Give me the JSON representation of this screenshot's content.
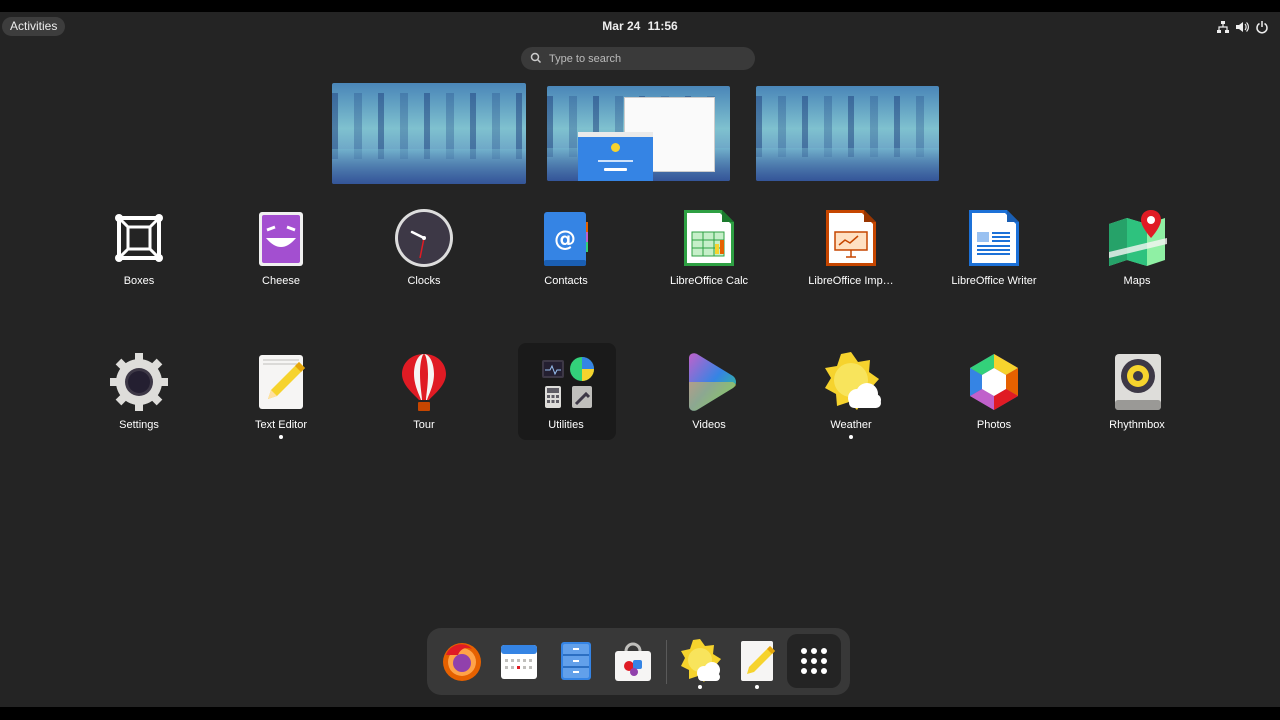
{
  "topbar": {
    "activities": "Activities",
    "date": "Mar 24",
    "time": "11:56",
    "tray_icons": [
      "network-icon",
      "volume-icon",
      "power-icon"
    ]
  },
  "search": {
    "placeholder": "Type to search"
  },
  "workspaces": [
    {
      "name": "workspace-1",
      "windows": []
    },
    {
      "name": "workspace-2",
      "windows": [
        "Welcome to Weather window",
        "blank white window"
      ]
    },
    {
      "name": "workspace-3",
      "windows": []
    }
  ],
  "apps": {
    "row1": [
      {
        "label": "Boxes",
        "icon": "boxes-icon"
      },
      {
        "label": "Cheese",
        "icon": "cheese-icon"
      },
      {
        "label": "Clocks",
        "icon": "clocks-icon"
      },
      {
        "label": "Contacts",
        "icon": "contacts-icon"
      },
      {
        "label": "LibreOffice Calc",
        "icon": "libreoffice-calc-icon"
      },
      {
        "label": "LibreOffice Imp…",
        "icon": "libreoffice-impress-icon"
      },
      {
        "label": "LibreOffice Writer",
        "icon": "libreoffice-writer-icon"
      },
      {
        "label": "Maps",
        "icon": "maps-icon"
      }
    ],
    "row2": [
      {
        "label": "Settings",
        "icon": "settings-icon"
      },
      {
        "label": "Text Editor",
        "icon": "text-editor-icon",
        "running": true
      },
      {
        "label": "Tour",
        "icon": "tour-icon"
      },
      {
        "label": "Utilities",
        "icon": "utilities-folder-icon"
      },
      {
        "label": "Videos",
        "icon": "videos-icon"
      },
      {
        "label": "Weather",
        "icon": "weather-icon",
        "running": true
      },
      {
        "label": "Photos",
        "icon": "photos-icon"
      },
      {
        "label": "Rhythmbox",
        "icon": "rhythmbox-icon"
      }
    ]
  },
  "dash": [
    {
      "icon": "firefox-icon"
    },
    {
      "icon": "calendar-icon"
    },
    {
      "icon": "files-icon"
    },
    {
      "icon": "software-icon"
    },
    {
      "icon": "weather-icon",
      "running": true
    },
    {
      "icon": "text-editor-icon",
      "running": true
    },
    {
      "icon": "show-apps-icon"
    }
  ],
  "colors": {
    "background": "#242424",
    "dash": "#383838",
    "search": "#3a3a3a"
  }
}
